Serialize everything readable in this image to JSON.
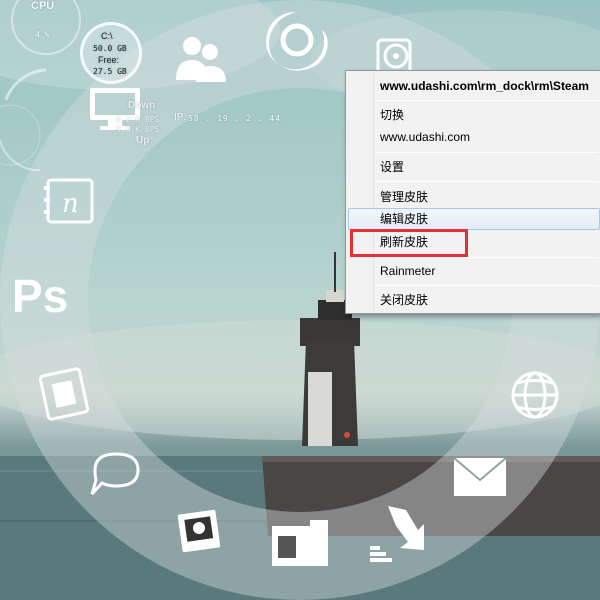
{
  "colors": {
    "accent_red": "#e63131",
    "ring": "rgba(220,225,225,0.35)",
    "sky_top": "#9bc4c4",
    "sea": "#4e6c70"
  },
  "widgets": {
    "cpu": {
      "label": "CPU",
      "value": "4 %"
    },
    "disk": {
      "drive": "C:\\",
      "total": "50.0 GB",
      "free_label": "Free:",
      "free": "27.5 GB"
    },
    "network": {
      "down_label": "Down",
      "down_value": "0.2 K BPS",
      "up_value": "9.8 K BPS",
      "up_label": "Up",
      "ip_label": "IP:",
      "ip_value": "58 . 19 . 2 . 44"
    }
  },
  "dock_icons": [
    {
      "name": "firefox-icon"
    },
    {
      "name": "users-icon"
    },
    {
      "name": "music-icon"
    },
    {
      "name": "computer-icon"
    },
    {
      "name": "notebook-icon"
    },
    {
      "name": "photoshop-icon",
      "text": "Ps"
    },
    {
      "name": "film-icon"
    },
    {
      "name": "chat-icon"
    },
    {
      "name": "photo-icon"
    },
    {
      "name": "folder-icon"
    },
    {
      "name": "download-icon"
    },
    {
      "name": "mail-icon"
    },
    {
      "name": "globe-icon"
    }
  ],
  "context_menu": {
    "header": "www.udashi.com\\rm_dock\\rm\\Steam",
    "items": [
      {
        "label": "切换"
      },
      {
        "label": "www.udashi.com"
      },
      {
        "label": "设置"
      },
      {
        "label": "管理皮肤"
      },
      {
        "label": "编辑皮肤"
      },
      {
        "label": "刷新皮肤"
      },
      {
        "label": "Rainmeter"
      },
      {
        "label": "关闭皮肤"
      }
    ]
  }
}
